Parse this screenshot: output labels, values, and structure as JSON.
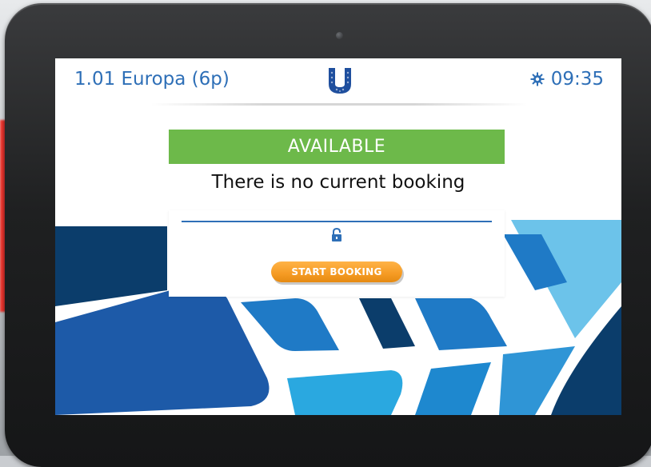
{
  "header": {
    "room_name": "1.01 Europa (6p)",
    "time": "09:35",
    "settings_icon": "gear-icon",
    "logo_icon": "unilever-logo"
  },
  "status": {
    "badge": "AVAILABLE",
    "message": "There is no current booking",
    "badge_color": "#6db94a"
  },
  "card": {
    "lock_icon": "lock-icon",
    "start_button": "START BOOKING",
    "button_color": "#f59b23"
  },
  "colors": {
    "accent": "#2e6fb7",
    "tile_dark": "#0b3d6b",
    "tile_mid": "#1f7ac6",
    "tile_light": "#6cc3ea"
  }
}
